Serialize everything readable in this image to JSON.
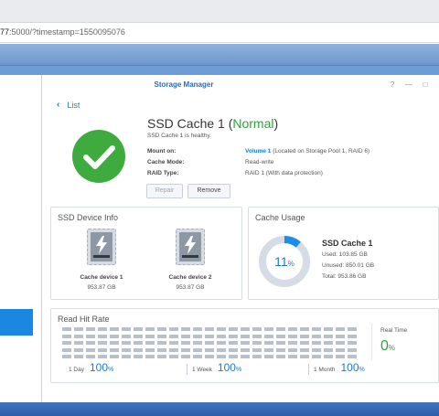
{
  "browser": {
    "url_prefix": "",
    "url_bold": "77",
    "url_rest": ":5000/?timestamp=1550095076"
  },
  "window": {
    "title": "Storage Manager",
    "help_icon": "?",
    "minimize_icon": "—",
    "maximize_icon": "□"
  },
  "nav": {
    "back_label": "List"
  },
  "cache": {
    "title_prefix": "SSD Cache 1 (",
    "status": "Normal",
    "title_suffix": ")",
    "subtitle": "SSD Cache 1 is healthy.",
    "mount_label": "Mount on:",
    "mount_link": "Volume 1",
    "mount_rest": " (Located on Storage Pool 1, RAID 6)",
    "mode_label": "Cache Mode:",
    "mode_value": "Read-write",
    "raid_label": "RAID Type:",
    "raid_value": "RAID 1 (With data protection)",
    "repair_label": "Repair",
    "remove_label": "Remove"
  },
  "devices": {
    "title": "SSD Device Info",
    "items": [
      {
        "name": "Cache device 1",
        "size": "953.87 GB"
      },
      {
        "name": "Cache device 2",
        "size": "953.87 GB"
      }
    ]
  },
  "usage": {
    "title": "Cache Usage",
    "percent": "11",
    "percent_unit": "%",
    "fraction": 0.11,
    "name": "SSD Cache 1",
    "used": "Used: 103.85 GB",
    "unused": "Unused: 850.01 GB",
    "total": "Total: 953.86 GB",
    "colors": {
      "used": "#1b8ee6",
      "free": "#d5dce5"
    }
  },
  "hit_rate": {
    "title": "Read Hit Rate",
    "realtime_label": "Real Time",
    "realtime_value": "0",
    "realtime_unit": "%",
    "periods": [
      {
        "label": "1 Day",
        "value": "100",
        "unit": "%"
      },
      {
        "label": "1 Week",
        "value": "100",
        "unit": "%"
      },
      {
        "label": "1 Month",
        "value": "100",
        "unit": "%"
      }
    ]
  },
  "colors": {
    "accent": "#1b79d6",
    "ok": "#2ea33a",
    "title": "#2b6ab4"
  }
}
